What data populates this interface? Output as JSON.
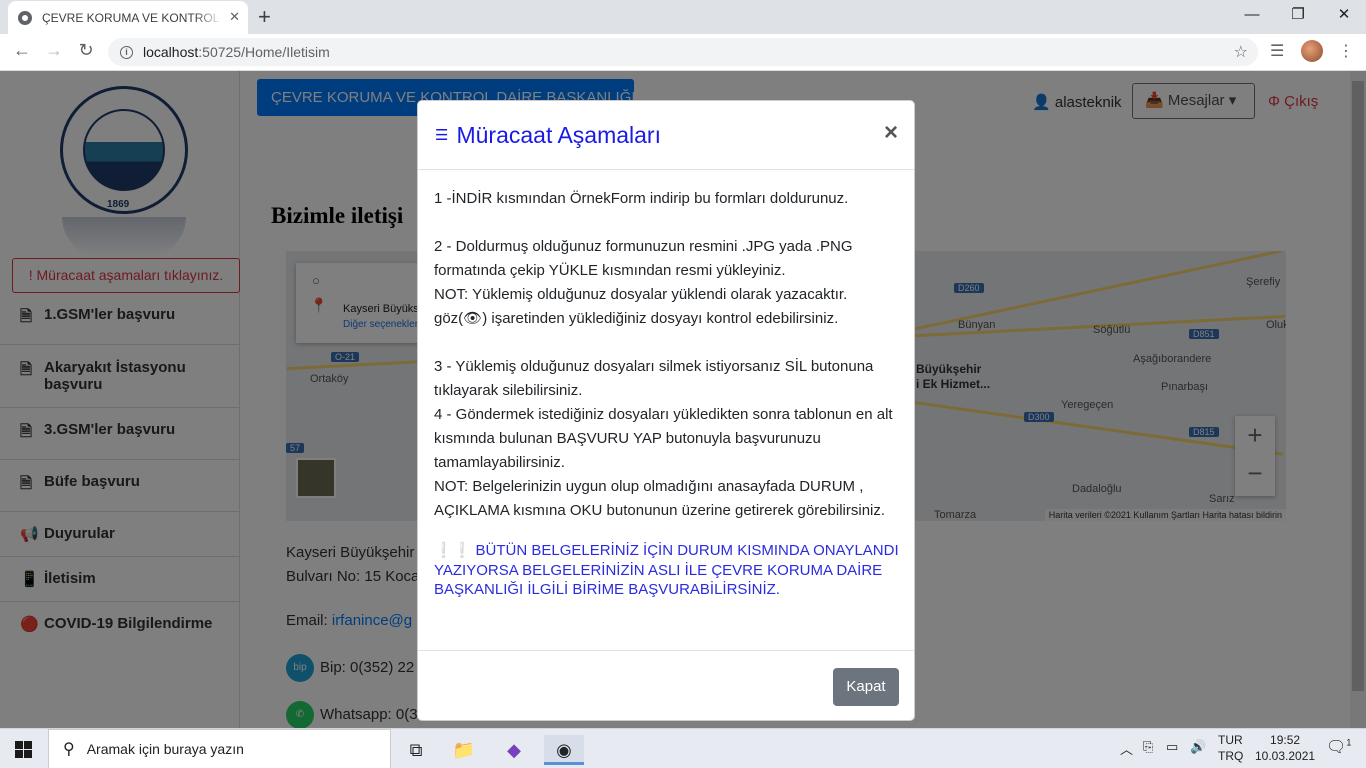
{
  "browser": {
    "tab_title": "ÇEVRE KORUMA VE KONTROL DAİRE",
    "url_host": "localhost",
    "url_path": ":50725/Home/Iletisim"
  },
  "page": {
    "top_button": "ÇEVRE KORUMA VE KONTROL DAİRE BAŞKANLIĞI",
    "user_name": "alasteknik",
    "messages_label": "Mesajlar",
    "logout_label": "Çıkış",
    "logo_year": "1869",
    "notice": "! Müracaat aşamaları tıklayınız.",
    "menu": [
      {
        "icon": "document-icon",
        "glyph": "🗎",
        "label": "1.GSM'ler başvuru"
      },
      {
        "icon": "document-icon",
        "glyph": "🗎",
        "label": "Akaryakıt İstasyonu başvuru"
      },
      {
        "icon": "document-icon",
        "glyph": "🗎",
        "label": "3.GSM'ler başvuru"
      },
      {
        "icon": "document-icon",
        "glyph": "🗎",
        "label": "Büfe başvuru"
      },
      {
        "icon": "megaphone-icon",
        "glyph": "📢",
        "label": "Duyurular"
      },
      {
        "icon": "mobile-icon",
        "glyph": "📱",
        "label": "İletisim"
      },
      {
        "icon": "red-circle-icon",
        "glyph": "🔴",
        "label": "COVID-19 Bilgilendirme"
      }
    ],
    "headline": "Bizimle iletişi",
    "map": {
      "place_name": "Kayseri Büyüks",
      "more_options": "Diğer seçenekler",
      "labels": [
        "Şerefiy",
        "Bünyan",
        "Söğütlü",
        "Oluk",
        "Büyükşehir",
        "i Ek Hizmet...",
        "Aşağıborandere",
        "Ortaköy",
        "Pınarbaşı",
        "Yeregeçen",
        "Dadaloğlu",
        "Sarız",
        "Tomarza"
      ],
      "shields": [
        "D260",
        "D851",
        "O-21",
        "D300",
        "D815",
        "57"
      ],
      "attribution": "Harita verileri ©2021   Kullanım Şartları   Harita hatası bildirin"
    },
    "contact": {
      "address_1": "Kayseri Büyükşehir",
      "address_2": "Bulvarı No: 15 Koca",
      "email_label": "Email:",
      "email": "irfanince@g",
      "bip": "Bip: 0(352) 22",
      "whatsapp": "Whatsapp: 0(3"
    }
  },
  "modal": {
    "title": "Müracaat Aşamaları",
    "step1": "1 -İNDİR kısmından ÖrnekForm indirip bu formları doldurunuz.",
    "step2": "2 - Doldurmuş olduğunuz formunuzun resmini .JPG yada .PNG formatında çekip YÜKLE kısmından resmi yükleyiniz.",
    "note1": "NOT: Yüklemiş olduğunuz dosyalar yüklendi olarak yazacaktır.",
    "note1b": "göz(👁) işaretinden yüklediğiniz dosyayı kontrol edebilirsiniz.",
    "step3": "3 - Yüklemiş olduğunuz dosyaları silmek istiyorsanız SİL butonuna tıklayarak silebilirsiniz.",
    "step4": "4 - Göndermek istediğiniz dosyaları yükledikten sonra tablonun en alt kısmında bulunan BAŞVURU YAP butonuyla başvurunuzu tamamlayabilirsiniz.",
    "note2": "NOT: Belgelerinizin uygun olup olmadığını anasayfada DURUM , AÇIKLAMA kısmına OKU butonunun üzerine getirerek görebilirsiniz.",
    "warning": "❕❕ BÜTÜN BELGELERİNİZ İÇİN DURUM KISMINDA ONAYLANDI YAZIYORSA BELGELERİNİZİN ASLI İLE ÇEVRE KORUMA DAİRE BAŞKANLIĞI İLGİLİ BİRİME BAŞVURABİLİRSİNİZ.",
    "close_button": "Kapat"
  },
  "taskbar": {
    "search_placeholder": "Aramak için buraya yazın",
    "lang_1": "TUR",
    "lang_2": "TRQ",
    "time": "19:52",
    "date": "10.03.2021",
    "notification_count": "1"
  }
}
